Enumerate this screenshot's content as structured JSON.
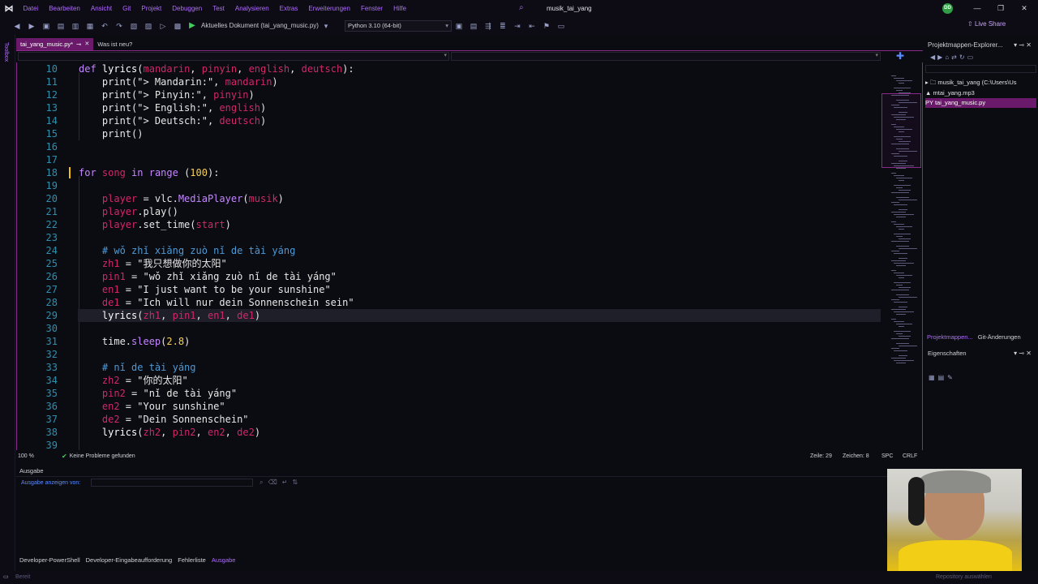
{
  "menu": [
    "Datei",
    "Bearbeiten",
    "Ansicht",
    "Git",
    "Projekt",
    "Debuggen",
    "Test",
    "Analysieren",
    "Extras",
    "Erweiterungen",
    "Fenster",
    "Hilfe"
  ],
  "window_title": "musik_tai_yang",
  "avatar_initials": "DD",
  "toolbar": {
    "run_label": "Aktuelles Dokument (tai_yang_music.py)",
    "python_env": "Python 3.10 (64-bit)",
    "live_share": "Live Share"
  },
  "left_rail_label": "Toolbox",
  "tabs": [
    {
      "label": "tai_yang_music.py*",
      "active": true
    },
    {
      "label": "Was ist neu?",
      "active": false
    }
  ],
  "code_lines": [
    {
      "n": "10",
      "tokens": [
        [
          "kw",
          "def "
        ],
        [
          "fn",
          "lyrics"
        ],
        [
          "st",
          "("
        ],
        [
          "pr",
          "mandarin"
        ],
        [
          "st",
          ", "
        ],
        [
          "pr",
          "pinyin"
        ],
        [
          "st",
          ", "
        ],
        [
          "pr",
          "english"
        ],
        [
          "st",
          ", "
        ],
        [
          "pr",
          "deutsch"
        ],
        [
          "st",
          "):"
        ]
      ]
    },
    {
      "n": "11",
      "tokens": [
        [
          "st",
          "    print(\"> Mandarin:\", "
        ],
        [
          "pr",
          "mandarin"
        ],
        [
          "st",
          ")"
        ]
      ]
    },
    {
      "n": "12",
      "tokens": [
        [
          "st",
          "    print(\"> Pinyin:\", "
        ],
        [
          "pr",
          "pinyin"
        ],
        [
          "st",
          ")"
        ]
      ]
    },
    {
      "n": "13",
      "tokens": [
        [
          "st",
          "    print(\"> English:\", "
        ],
        [
          "pr",
          "english"
        ],
        [
          "st",
          ")"
        ]
      ]
    },
    {
      "n": "14",
      "tokens": [
        [
          "st",
          "    print(\"> Deutsch:\", "
        ],
        [
          "pr",
          "deutsch"
        ],
        [
          "st",
          ")"
        ]
      ]
    },
    {
      "n": "15",
      "tokens": [
        [
          "st",
          "    print()"
        ]
      ]
    },
    {
      "n": "16",
      "tokens": []
    },
    {
      "n": "17",
      "tokens": []
    },
    {
      "n": "18",
      "tokens": [
        [
          "kw",
          "for "
        ],
        [
          "pr",
          "song"
        ],
        [
          "kw",
          " in "
        ],
        [
          "bi",
          "range"
        ],
        [
          "st",
          " ("
        ],
        [
          "nm",
          "100"
        ],
        [
          "st",
          "):"
        ]
      ]
    },
    {
      "n": "19",
      "tokens": []
    },
    {
      "n": "20",
      "tokens": [
        [
          "pr",
          "    player"
        ],
        [
          "st",
          " = vlc."
        ],
        [
          "bi",
          "MediaPlayer"
        ],
        [
          "st",
          "("
        ],
        [
          "pr",
          "musik"
        ],
        [
          "st",
          ")"
        ]
      ]
    },
    {
      "n": "21",
      "tokens": [
        [
          "pr",
          "    player"
        ],
        [
          "st",
          ".play()"
        ]
      ]
    },
    {
      "n": "22",
      "tokens": [
        [
          "pr",
          "    player"
        ],
        [
          "st",
          ".set_time("
        ],
        [
          "pr",
          "start"
        ],
        [
          "st",
          ")"
        ]
      ]
    },
    {
      "n": "23",
      "tokens": []
    },
    {
      "n": "24",
      "tokens": [
        [
          "cm",
          "    # wǒ zhǐ xiǎng zuò nǐ de tài yáng"
        ]
      ]
    },
    {
      "n": "25",
      "tokens": [
        [
          "pr",
          "    zh1"
        ],
        [
          "st",
          " = \"我只想做你的太阳\""
        ]
      ]
    },
    {
      "n": "26",
      "tokens": [
        [
          "pr",
          "    pin1"
        ],
        [
          "st",
          " = \"wǒ zhǐ xiǎng zuò nǐ de tài yáng\""
        ]
      ]
    },
    {
      "n": "27",
      "tokens": [
        [
          "pr",
          "    en1"
        ],
        [
          "st",
          " = \"I just want to be your sunshine\""
        ]
      ]
    },
    {
      "n": "28",
      "tokens": [
        [
          "pr",
          "    de1"
        ],
        [
          "st",
          " = \"Ich will nur dein Sonnenschein sein\""
        ]
      ]
    },
    {
      "n": "29",
      "tokens": [
        [
          "fn",
          "    lyrics"
        ],
        [
          "st",
          "("
        ],
        [
          "pr",
          "zh1"
        ],
        [
          "st",
          ", "
        ],
        [
          "pr",
          "pin1"
        ],
        [
          "st",
          ", "
        ],
        [
          "pr",
          "en1"
        ],
        [
          "st",
          ", "
        ],
        [
          "pr",
          "de1"
        ],
        [
          "st",
          ")"
        ]
      ],
      "current": true
    },
    {
      "n": "30",
      "tokens": []
    },
    {
      "n": "31",
      "tokens": [
        [
          "st",
          "    time."
        ],
        [
          "bi",
          "sleep"
        ],
        [
          "st",
          "("
        ],
        [
          "nm",
          "2.8"
        ],
        [
          "st",
          ")"
        ]
      ]
    },
    {
      "n": "32",
      "tokens": []
    },
    {
      "n": "33",
      "tokens": [
        [
          "cm",
          "    # nǐ de tài yáng"
        ]
      ]
    },
    {
      "n": "34",
      "tokens": [
        [
          "pr",
          "    zh2"
        ],
        [
          "st",
          " = \"你的太阳\""
        ]
      ]
    },
    {
      "n": "35",
      "tokens": [
        [
          "pr",
          "    pin2"
        ],
        [
          "st",
          " = \"nǐ de tài yáng\""
        ]
      ]
    },
    {
      "n": "36",
      "tokens": [
        [
          "pr",
          "    en2"
        ],
        [
          "st",
          " = \"Your sunshine\""
        ]
      ]
    },
    {
      "n": "37",
      "tokens": [
        [
          "pr",
          "    de2"
        ],
        [
          "st",
          " = \"Dein Sonnenschein\""
        ]
      ]
    },
    {
      "n": "38",
      "tokens": [
        [
          "fn",
          "    lyrics"
        ],
        [
          "st",
          "("
        ],
        [
          "pr",
          "zh2"
        ],
        [
          "st",
          ", "
        ],
        [
          "pr",
          "pin2"
        ],
        [
          "st",
          ", "
        ],
        [
          "pr",
          "en2"
        ],
        [
          "st",
          ", "
        ],
        [
          "pr",
          "de2"
        ],
        [
          "st",
          ")"
        ]
      ]
    },
    {
      "n": "39",
      "tokens": []
    }
  ],
  "editor_status": {
    "zoom": "100 %",
    "problems": "Keine Probleme gefunden",
    "line": "Zeile: 29",
    "col": "Zeichen: 8",
    "spc": "SPC",
    "eol": "CRLF"
  },
  "solution_explorer": {
    "title": "Projektmappen-Explorer...",
    "items": [
      {
        "label": "▸  🗀 musik_tai_yang (C:\\Users\\Us",
        "selected": false
      },
      {
        "label": "      ▲ mtai_yang.mp3",
        "selected": false
      },
      {
        "label": "      PY  tai_yang_music.py",
        "selected": true
      }
    ],
    "tab1": "Projektmappen...",
    "tab2": "Git-Änderungen"
  },
  "properties_title": "Eigenschaften",
  "output": {
    "title": "Ausgabe",
    "from_label": "Ausgabe anzeigen von:"
  },
  "bottom_tabs": [
    {
      "label": "Developer-PowerShell",
      "active": false
    },
    {
      "label": "Developer-Eingabeaufforderung",
      "active": false
    },
    {
      "label": "Fehlerliste",
      "active": false
    },
    {
      "label": "Ausgabe",
      "active": true
    }
  ],
  "statusbar": {
    "state": "Bereit",
    "repo": "Repository auswählen"
  },
  "colors": {
    "accent": "#b06cff",
    "active_tab": "#6b1a6b",
    "param": "#d2276a",
    "number": "#f5d05a",
    "comment": "#4d9ad6"
  }
}
